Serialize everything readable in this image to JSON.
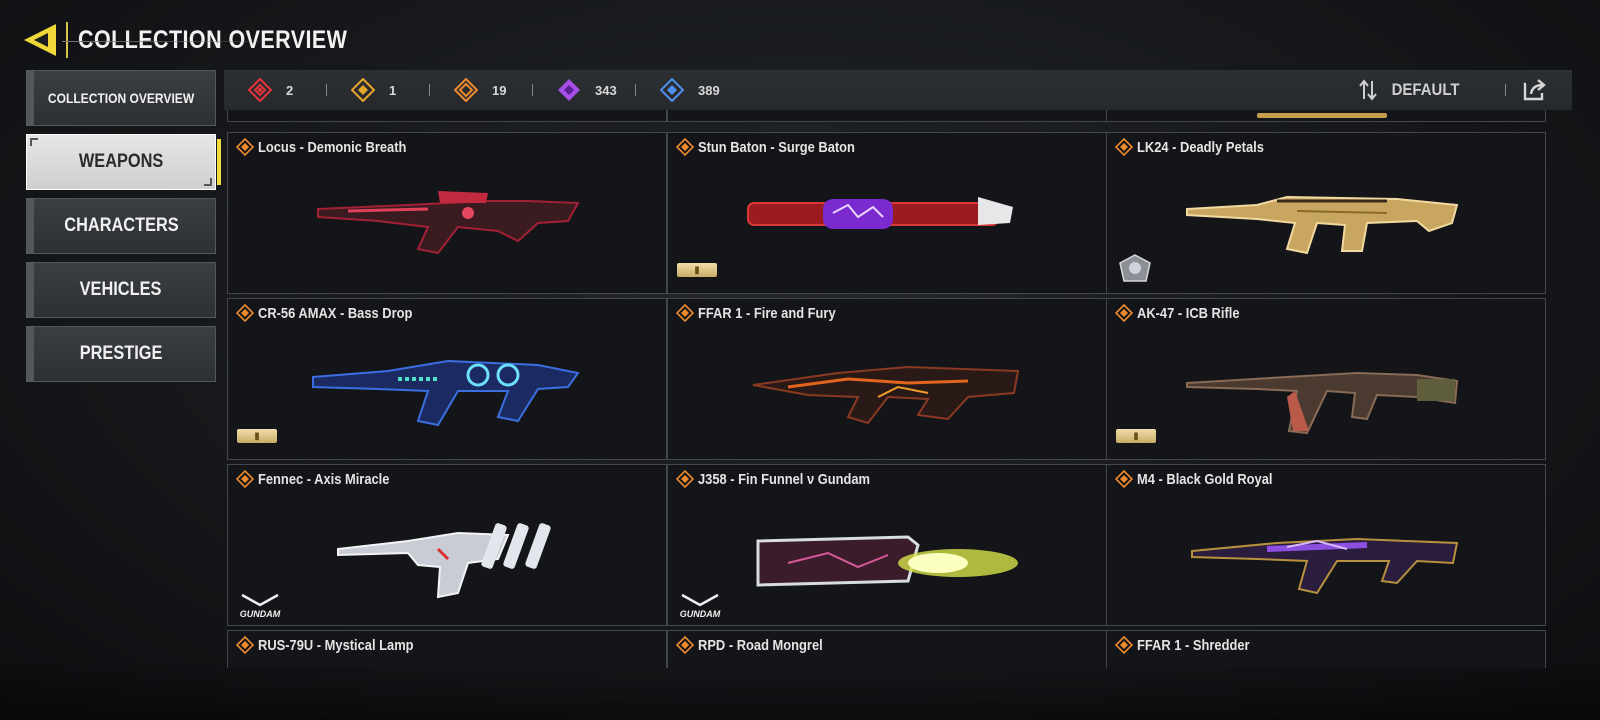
{
  "header": {
    "title": "COLLECTION OVERVIEW"
  },
  "sidebar": {
    "items": [
      {
        "label": "COLLECTION OVERVIEW",
        "active": false
      },
      {
        "label": "WEAPONS",
        "active": true
      },
      {
        "label": "CHARACTERS",
        "active": false
      },
      {
        "label": "VEHICLES",
        "active": false
      },
      {
        "label": "PRESTIGE",
        "active": false
      }
    ]
  },
  "counters": [
    {
      "rarity": "mythic",
      "color": "#e8333d",
      "value": "2"
    },
    {
      "rarity": "legendary-gold",
      "color": "#e7a52b",
      "value": "1"
    },
    {
      "rarity": "legendary",
      "color": "#ee8a2e",
      "value": "19"
    },
    {
      "rarity": "epic",
      "color": "#a64ee8",
      "value": "343"
    },
    {
      "rarity": "rare",
      "color": "#4c8ff0",
      "value": "389"
    }
  ],
  "sort": {
    "label": "DEFAULT",
    "icon": "sort-arrows-icon"
  },
  "share": {
    "icon": "share-icon"
  },
  "cards": [
    {
      "title": "Locus - Demonic Breath",
      "badge": "",
      "accent": "#d2283e"
    },
    {
      "title": "Stun Baton - Surge Baton",
      "badge": "mastery",
      "accent": "#b61d24"
    },
    {
      "title": "LK24 - Deadly Petals",
      "badge": "prestige",
      "accent": "#d9b25a"
    },
    {
      "title": "CR-56 AMAX - Bass Drop",
      "badge": "mastery",
      "accent": "#3b6fe0"
    },
    {
      "title": "FFAR 1 - Fire and Fury",
      "badge": "",
      "accent": "#d0541e"
    },
    {
      "title": "AK-47 - ICB Rifle",
      "badge": "mastery",
      "accent": "#8a3b33"
    },
    {
      "title": "Fennec - Axis Miracle",
      "badge": "gundam",
      "accent": "#c9ccd4"
    },
    {
      "title": "J358 - Fin Funnel ν Gundam",
      "badge": "gundam",
      "accent": "#d7e24a"
    },
    {
      "title": "M4 - Black Gold Royal",
      "badge": "",
      "accent": "#8c4fe0"
    }
  ],
  "partial_cards": [
    {
      "title": "RUS-79U - Mystical Lamp"
    },
    {
      "title": "RPD - Road Mongrel"
    },
    {
      "title": "FFAR 1 - Shredder"
    }
  ],
  "badges": {
    "gundam_text": "GUNDAM"
  }
}
